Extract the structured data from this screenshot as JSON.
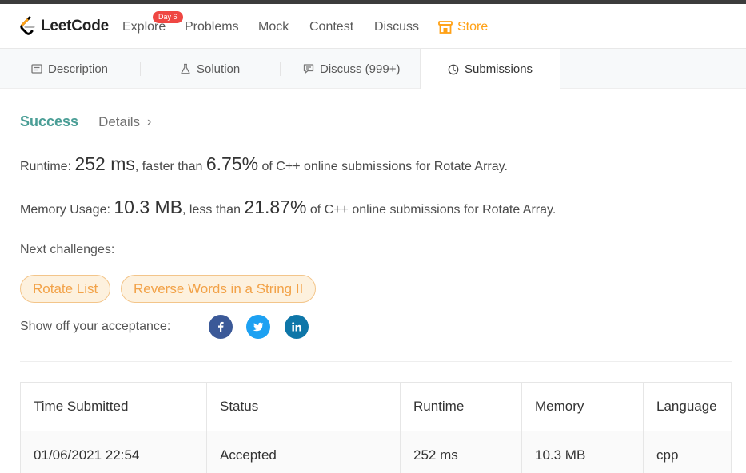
{
  "nav": {
    "brand": "LeetCode",
    "explore": "Explore",
    "explore_badge": "Day 6",
    "problems": "Problems",
    "mock": "Mock",
    "contest": "Contest",
    "discuss": "Discuss",
    "store": "Store"
  },
  "tabs": [
    {
      "label": "Description",
      "icon": "description-icon"
    },
    {
      "label": "Solution",
      "icon": "flask-icon"
    },
    {
      "label": "Discuss (999+)",
      "icon": "discuss-icon"
    },
    {
      "label": "Submissions",
      "icon": "clock-icon",
      "active": true
    }
  ],
  "result": {
    "status": "Success",
    "details": "Details",
    "runtime_label": "Runtime: ",
    "runtime_value": "252 ms",
    "runtime_mid": ", faster than ",
    "runtime_pct": "6.75%",
    "runtime_tail": " of C++ online submissions for Rotate Array.",
    "memory_label": "Memory Usage: ",
    "memory_value": "10.3 MB",
    "memory_mid": ", less than ",
    "memory_pct": "21.87%",
    "memory_tail": " of C++ online submissions for Rotate Array."
  },
  "challenges": {
    "label": "Next challenges:",
    "items": [
      "Rotate List",
      "Reverse Words in a String II"
    ]
  },
  "share": {
    "label": "Show off your acceptance:",
    "networks": [
      "facebook-icon",
      "twitter-icon",
      "linkedin-icon"
    ]
  },
  "submissions": {
    "headers": [
      "Time Submitted",
      "Status",
      "Runtime",
      "Memory",
      "Language"
    ],
    "rows": [
      [
        "01/06/2021 22:54",
        "Accepted",
        "252 ms",
        "10.3 MB",
        "cpp"
      ]
    ]
  },
  "colors": {
    "accent": "#ffa116",
    "success": "#4a9e96",
    "facebook": "#3b5998",
    "twitter": "#1da1f2",
    "linkedin": "#0e76a8"
  }
}
